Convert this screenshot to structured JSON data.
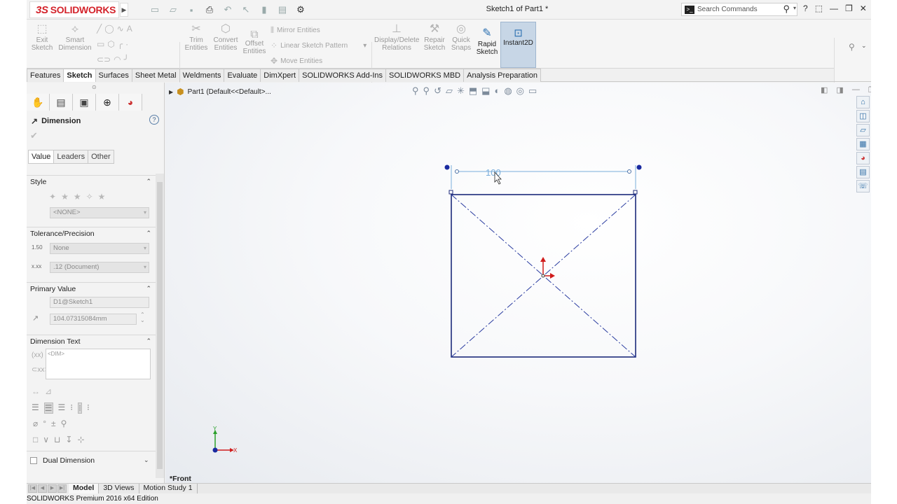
{
  "app": {
    "logo": "SOLIDWORKS",
    "doc_title": "Sketch1 of Part1 *",
    "search_placeholder": "Search Commands"
  },
  "ribbon": {
    "exit_sketch": "Exit Sketch",
    "smart_dimension": "Smart Dimension",
    "trim_entities": "Trim Entities",
    "convert_entities": "Convert Entities",
    "offset_entities": "Offset Entities",
    "mirror_entities": "Mirror Entities",
    "linear_sketch_pattern": "Linear Sketch Pattern",
    "move_entities": "Move Entities",
    "display_delete_relations": "Display/Delete Relations",
    "repair_sketch": "Repair Sketch",
    "quick_snaps": "Quick Snaps",
    "rapid_sketch": "Rapid Sketch",
    "instant2d": "Instant2D"
  },
  "tabs": [
    "Features",
    "Sketch",
    "Surfaces",
    "Sheet Metal",
    "Weldments",
    "Evaluate",
    "DimXpert",
    "SOLIDWORKS Add-Ins",
    "SOLIDWORKS MBD",
    "Analysis Preparation"
  ],
  "active_tab": "Sketch",
  "property_manager": {
    "title": "Dimension",
    "subtabs": [
      "Value",
      "Leaders",
      "Other"
    ],
    "style": {
      "header": "Style",
      "dropdown": "<NONE>"
    },
    "tolerance": {
      "header": "Tolerance/Precision",
      "tolerance_value": "None",
      "precision_value": ".12 (Document)",
      "tolerance_icon_label": "1.50",
      "precision_icon_label": "x.xx"
    },
    "primary_value": {
      "header": "Primary Value",
      "name": "D1@Sketch1",
      "value": "104.07315084mm"
    },
    "dimension_text": {
      "header": "Dimension Text",
      "text": "<DIM>"
    },
    "dual_dimension": "Dual Dimension"
  },
  "viewport": {
    "tree_item": "Part1  (Default<<Default>...",
    "dimension_value": "100",
    "view_label": "*Front",
    "axis_y": "Y",
    "axis_x": "X"
  },
  "bottom_tabs": [
    "Model",
    "3D Views",
    "Motion Study 1"
  ],
  "active_bottom_tab": "Model",
  "status": "SOLIDWORKS Premium 2016 x64 Edition",
  "colors": {
    "sketch_line": "#1c2a7a",
    "construction_line": "#2a3ca0",
    "dimension": "#7aaedb",
    "origin_red": "#d01c1c",
    "active_tab_bg": "#ffffff",
    "instant2d_bg": "#c7d6e6"
  }
}
